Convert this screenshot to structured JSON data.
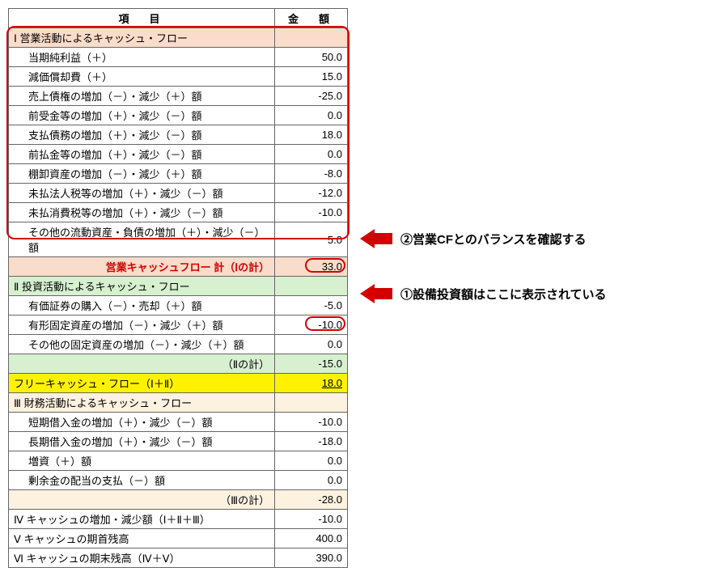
{
  "header": {
    "item": "項　目",
    "amount": "金　額"
  },
  "section1": {
    "title": "Ⅰ 営業活動によるキャッシュ・フロー",
    "rows": [
      {
        "label": "当期純利益（＋）",
        "value": "50.0"
      },
      {
        "label": "減価償却費（＋）",
        "value": "15.0"
      },
      {
        "label": "売上債権の増加（－）・減少（＋）額",
        "value": "-25.0"
      },
      {
        "label": "前受金等の増加（＋）・減少（－）額",
        "value": "0.0"
      },
      {
        "label": "支払債務の増加（＋）・減少（－）額",
        "value": "18.0"
      },
      {
        "label": "前払金等の増加（＋）・減少（－）額",
        "value": "0.0"
      },
      {
        "label": "棚卸資産の増加（－）・減少（＋）額",
        "value": "-8.0"
      },
      {
        "label": "未払法人税等の増加（＋）・減少（－）額",
        "value": "-12.0"
      },
      {
        "label": "未払消費税等の増加（＋）・減少（－）額",
        "value": "-10.0"
      },
      {
        "label": "その他の流動資産・負債の増加（＋）・減少（－）額",
        "value": "5.0"
      }
    ],
    "subtotal": {
      "label": "営業キャッシュフロー 計（Ⅰの計）",
      "value": "33.0"
    }
  },
  "section2": {
    "title": "Ⅱ 投資活動によるキャッシュ・フロー",
    "rows": [
      {
        "label": "有価証券の購入（－）・売却（＋）額",
        "value": "-5.0"
      },
      {
        "label": "有形固定資産の増加（－）・減少（＋）額",
        "value": "-10.0"
      },
      {
        "label": "その他の固定資産の増加（－）・減少（＋）額",
        "value": "0.0"
      }
    ],
    "subtotal": {
      "label": "（Ⅱの計）",
      "value": "-15.0"
    }
  },
  "free_cf": {
    "label": "フリーキャッシュ・フロー（Ⅰ＋Ⅱ）",
    "value": "18.0"
  },
  "section3": {
    "title": "Ⅲ 財務活動によるキャッシュ・フロー",
    "rows": [
      {
        "label": "短期借入金の増加（＋）・減少（－）額",
        "value": "-10.0"
      },
      {
        "label": "長期借入金の増加（＋）・減少（－）額",
        "value": "-18.0"
      },
      {
        "label": "増資（＋）額",
        "value": "0.0"
      },
      {
        "label": "剰余金の配当の支払（－）額",
        "value": "0.0"
      }
    ],
    "subtotal": {
      "label": "（Ⅲの計）",
      "value": "-28.0"
    }
  },
  "bottom": [
    {
      "label": "Ⅳ キャッシュの増加・減少額（Ⅰ＋Ⅱ＋Ⅲ）",
      "value": "-10.0"
    },
    {
      "label": "Ⅴ キャッシュの期首残高",
      "value": "400.0"
    },
    {
      "label": "Ⅵ キャッシュの期末残高（Ⅳ＋Ⅴ）",
      "value": "390.0"
    }
  ],
  "annotations": {
    "a1": "①設備投資額はここに表示されている",
    "a2": "②営業CFとのバランスを確認する"
  },
  "chart_data": {
    "type": "table",
    "title": "キャッシュ・フロー計算書",
    "sections": [
      {
        "name": "営業活動によるキャッシュ・フロー",
        "items": [
          {
            "label": "当期純利益",
            "value": 50.0
          },
          {
            "label": "減価償却費",
            "value": 15.0
          },
          {
            "label": "売上債権の増減",
            "value": -25.0
          },
          {
            "label": "前受金等の増減",
            "value": 0.0
          },
          {
            "label": "支払債務の増減",
            "value": 18.0
          },
          {
            "label": "前払金等の増減",
            "value": 0.0
          },
          {
            "label": "棚卸資産の増減",
            "value": -8.0
          },
          {
            "label": "未払法人税等の増減",
            "value": -12.0
          },
          {
            "label": "未払消費税等の増減",
            "value": -10.0
          },
          {
            "label": "その他流動資産負債の増減",
            "value": 5.0
          }
        ],
        "subtotal": 33.0
      },
      {
        "name": "投資活動によるキャッシュ・フロー",
        "items": [
          {
            "label": "有価証券の購入売却",
            "value": -5.0
          },
          {
            "label": "有形固定資産の増減",
            "value": -10.0
          },
          {
            "label": "その他固定資産の増減",
            "value": 0.0
          }
        ],
        "subtotal": -15.0
      },
      {
        "name": "フリーキャッシュ・フロー",
        "subtotal": 18.0
      },
      {
        "name": "財務活動によるキャッシュ・フロー",
        "items": [
          {
            "label": "短期借入金の増減",
            "value": -10.0
          },
          {
            "label": "長期借入金の増減",
            "value": -18.0
          },
          {
            "label": "増資",
            "value": 0.0
          },
          {
            "label": "剰余金の配当支払",
            "value": 0.0
          }
        ],
        "subtotal": -28.0
      },
      {
        "name": "キャッシュ増減額",
        "subtotal": -10.0
      },
      {
        "name": "キャッシュ期首残高",
        "subtotal": 400.0
      },
      {
        "name": "キャッシュ期末残高",
        "subtotal": 390.0
      }
    ]
  }
}
